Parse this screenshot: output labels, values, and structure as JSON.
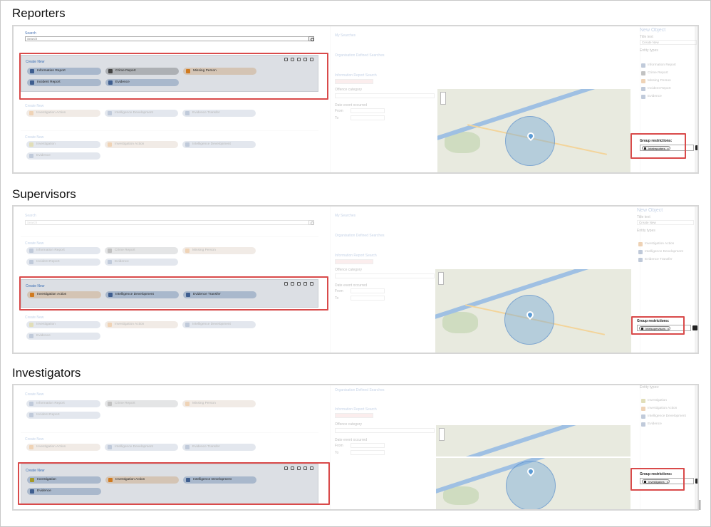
{
  "sections": [
    {
      "title": "Reporters",
      "search_label": "Search",
      "search_placeholder": "Search",
      "groups": [
        {
          "title": "Create New",
          "active": true,
          "pills": [
            {
              "label": "Information Report",
              "icon": "document-icon",
              "color": "blue"
            },
            {
              "label": "Crime Report",
              "icon": "person-icon",
              "color": "gray"
            },
            {
              "label": "Missing Person",
              "icon": "warning-icon",
              "color": "tan"
            },
            {
              "label": "Incident Report",
              "icon": "document-icon",
              "color": "blue"
            },
            {
              "label": "Evidence",
              "icon": "evidence-icon",
              "color": "blue"
            }
          ]
        },
        {
          "title": "Create New",
          "active": false,
          "pills": [
            {
              "label": "Investigation Action",
              "icon": "document-icon",
              "color": "tan"
            },
            {
              "label": "Intelligence Development",
              "icon": "document-icon",
              "color": "blue"
            },
            {
              "label": "Evidence Transfer",
              "icon": "document-icon",
              "color": "blue"
            }
          ]
        },
        {
          "title": "Create New",
          "active": false,
          "pills": [
            {
              "label": "Investigation",
              "icon": "folder-icon",
              "color": "blue"
            },
            {
              "label": "Investigation Action",
              "icon": "document-icon",
              "color": "tan"
            },
            {
              "label": "Intelligence Development",
              "icon": "document-icon",
              "color": "blue"
            },
            {
              "label": "Evidence",
              "icon": "evidence-icon",
              "color": "blue"
            }
          ]
        }
      ],
      "mid": {
        "my_searches": "My Searches",
        "org_searches": "Organisation Defined Searches",
        "ir_search": "Information Report Search",
        "offence": "Offence category",
        "date": "Date event occurred",
        "from": "From",
        "to": "To"
      },
      "right": {
        "title": "New Object",
        "title_text_label": "Title text",
        "title_text_value": "Create New",
        "entity_label": "Entity types",
        "entities": [
          {
            "label": "Information Report",
            "icon": "document-icon"
          },
          {
            "label": "Crime Report",
            "icon": "person-icon"
          },
          {
            "label": "Missing Person",
            "icon": "warning-icon"
          },
          {
            "label": "Incident Report",
            "icon": "document-icon"
          },
          {
            "label": "Evidence",
            "icon": "evidence-icon"
          }
        ],
        "group_label": "Group restrictions:",
        "group_chip": "Intelreporters"
      }
    },
    {
      "title": "Supervisors",
      "search_label": "Search",
      "search_placeholder": "Search",
      "groups": [
        {
          "title": "Create New",
          "active": false,
          "pills": [
            {
              "label": "Information Report",
              "icon": "document-icon",
              "color": "blue"
            },
            {
              "label": "Crime Report",
              "icon": "person-icon",
              "color": "gray"
            },
            {
              "label": "Missing Person",
              "icon": "warning-icon",
              "color": "tan"
            },
            {
              "label": "Incident Report",
              "icon": "document-icon",
              "color": "blue"
            },
            {
              "label": "Evidence",
              "icon": "evidence-icon",
              "color": "blue"
            }
          ]
        },
        {
          "title": "Create New",
          "active": true,
          "pills": [
            {
              "label": "Investigation Action",
              "icon": "document-icon",
              "color": "tan"
            },
            {
              "label": "Intelligence Development",
              "icon": "document-icon",
              "color": "blue"
            },
            {
              "label": "Evidence Transfer",
              "icon": "document-icon",
              "color": "blue"
            }
          ]
        },
        {
          "title": "Create New",
          "active": false,
          "pills": [
            {
              "label": "Investigation",
              "icon": "folder-icon",
              "color": "blue"
            },
            {
              "label": "Investigation Action",
              "icon": "document-icon",
              "color": "tan"
            },
            {
              "label": "Intelligence Development",
              "icon": "document-icon",
              "color": "blue"
            },
            {
              "label": "Evidence",
              "icon": "evidence-icon",
              "color": "blue"
            }
          ]
        }
      ],
      "mid": {
        "my_searches": "My Searches",
        "org_searches": "Organisation Defined Searches",
        "ir_search": "Information Report Search",
        "offence": "Offence category",
        "date": "Date event occurred",
        "from": "From",
        "to": "To"
      },
      "right": {
        "title": "New Object",
        "title_text_label": "Title text",
        "title_text_value": "Create New",
        "entity_label": "Entity types",
        "entities": [
          {
            "label": "Investigation Action",
            "icon": "document-icon"
          },
          {
            "label": "Intelligence Development",
            "icon": "document-icon"
          },
          {
            "label": "Evidence Transfer",
            "icon": "document-icon"
          }
        ],
        "group_label": "Group restrictions:",
        "group_chip": "Intelsupervisors"
      }
    },
    {
      "title": "Investigators",
      "groups": [
        {
          "title": "Create New",
          "active": false,
          "pills": [
            {
              "label": "Information Report",
              "icon": "document-icon",
              "color": "blue"
            },
            {
              "label": "Crime Report",
              "icon": "person-icon",
              "color": "gray"
            },
            {
              "label": "Missing Person",
              "icon": "warning-icon",
              "color": "tan"
            },
            {
              "label": "Incident Report",
              "icon": "document-icon",
              "color": "blue"
            }
          ]
        },
        {
          "title": "Create New",
          "active": false,
          "pills": [
            {
              "label": "Investigation Action",
              "icon": "document-icon",
              "color": "tan"
            },
            {
              "label": "Intelligence Development",
              "icon": "document-icon",
              "color": "blue"
            },
            {
              "label": "Evidence Transfer",
              "icon": "document-icon",
              "color": "blue"
            }
          ]
        },
        {
          "title": "Create New",
          "active": true,
          "pills": [
            {
              "label": "Investigation",
              "icon": "folder-icon",
              "color": "blue"
            },
            {
              "label": "Investigation Action",
              "icon": "document-icon",
              "color": "tan"
            },
            {
              "label": "Intelligence Development",
              "icon": "document-icon",
              "color": "blue"
            },
            {
              "label": "Evidence",
              "icon": "evidence-icon",
              "color": "blue"
            }
          ]
        }
      ],
      "mid": {
        "org_searches": "Organisation Defined Searches",
        "ir_search": "Information Report Search",
        "offence": "Offence category",
        "date": "Date event occurred",
        "from": "From",
        "to": "To"
      },
      "right": {
        "entity_label": "Entity types:",
        "entities": [
          {
            "label": "Investigation",
            "icon": "folder-icon"
          },
          {
            "label": "Investigation Action",
            "icon": "document-icon"
          },
          {
            "label": "Intelligence Development",
            "icon": "document-icon"
          },
          {
            "label": "Evidence",
            "icon": "evidence-icon"
          }
        ],
        "group_label": "Group restrictions:",
        "group_chip": "Investigators"
      }
    }
  ]
}
